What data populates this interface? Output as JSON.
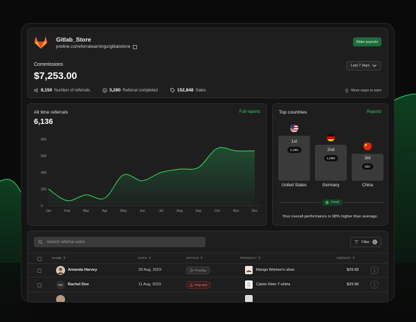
{
  "header": {
    "store_name": "Gitlab_Store",
    "store_url": "preline.co/referralearnings/gitlabstore",
    "payouts_label": "Make payouts",
    "commissions_label": "Commissions",
    "commissions_value": "$7,253.00",
    "range_label": "Last 7 days",
    "stats": [
      {
        "value": "8,150",
        "label": "Number of referrals",
        "icon": "megaphone-icon"
      },
      {
        "value": "3,280",
        "label": "Referral completed",
        "icon": "check-circle-icon"
      },
      {
        "value": "152,848",
        "label": "Sales",
        "icon": "tag-icon"
      }
    ],
    "ways_link": "More ways to earn"
  },
  "referrals": {
    "title": "All time referrals",
    "total": "6,136",
    "link": "Full reports"
  },
  "chart_data": {
    "type": "area",
    "categories": [
      "Jan",
      "Feb",
      "Mar",
      "Apr",
      "May",
      "Jun",
      "Jul",
      "Aug",
      "Sep",
      "Oct",
      "Nov",
      "Dec"
    ],
    "series": [
      {
        "values": [
          200,
          60,
          130,
          90,
          370,
          300,
          400,
          440,
          460,
          690,
          660,
          660
        ]
      }
    ],
    "yticks": [
      0,
      200,
      400,
      600,
      800
    ],
    "ylim": [
      0,
      800
    ],
    "grid": true,
    "color": "#34d058"
  },
  "countries": {
    "title": "Top countries",
    "link": "Reports",
    "items": [
      {
        "place": "1st",
        "count": "1,265",
        "name": "United States",
        "flag": "us-flag-icon"
      },
      {
        "place": "2nd",
        "count": "1,009",
        "name": "Germany",
        "flag": "de-flag-icon"
      },
      {
        "place": "3rd",
        "count": "922",
        "name": "China",
        "flag": "cn-flag-icon"
      }
    ],
    "badge": "Good",
    "performance": "Your overall performance is 98% higher than average."
  },
  "table": {
    "search_placeholder": "Search referral users",
    "filter_label": "Filter",
    "filter_count": "1",
    "columns": [
      "NAME",
      "DATE",
      "STATUS",
      "PRODUCT",
      "AMOUNT"
    ],
    "rows": [
      {
        "name": "Amanda Harvey",
        "date": "29 Aug, 2023",
        "status": "Pending",
        "product": "Mango Women's shoe",
        "amount": "$29.99"
      },
      {
        "name": "Rachel Doe",
        "initials": "RD",
        "date": "11 Aug, 2023",
        "status": "Rejected",
        "product": "Calvin Klein T-shirts",
        "amount": "$29.99"
      }
    ]
  }
}
